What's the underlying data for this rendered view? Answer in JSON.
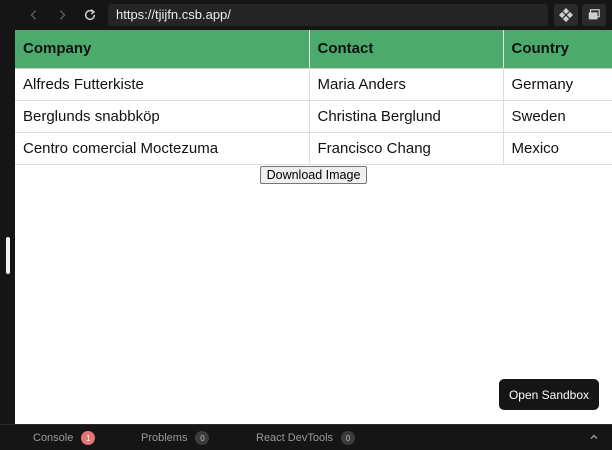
{
  "browser": {
    "url": "https://tjijfn.csb.app/"
  },
  "table": {
    "headers": [
      "Company",
      "Contact",
      "Country"
    ],
    "rows": [
      [
        "Alfreds Futterkiste",
        "Maria Anders",
        "Germany"
      ],
      [
        "Berglunds snabbköp",
        "Christina Berglund",
        "Sweden"
      ],
      [
        "Centro comercial Moctezuma",
        "Francisco Chang",
        "Mexico"
      ]
    ],
    "header_color": "#4caa6c"
  },
  "download_button": "Download Image",
  "open_sandbox": "Open Sandbox",
  "bottom_panel": {
    "tabs": [
      {
        "label": "Console",
        "count": "1",
        "badge_color": "#e57373"
      },
      {
        "label": "Problems",
        "count": "0",
        "badge_color": "#3b3b3b"
      },
      {
        "label": "React DevTools",
        "count": "0",
        "badge_color": "#3b3b3b"
      }
    ]
  },
  "icons": [
    "back-arrow-icon",
    "forward-arrow-icon",
    "refresh-icon",
    "devtools-icon",
    "preview-window-icon",
    "chevron-up-icon"
  ]
}
